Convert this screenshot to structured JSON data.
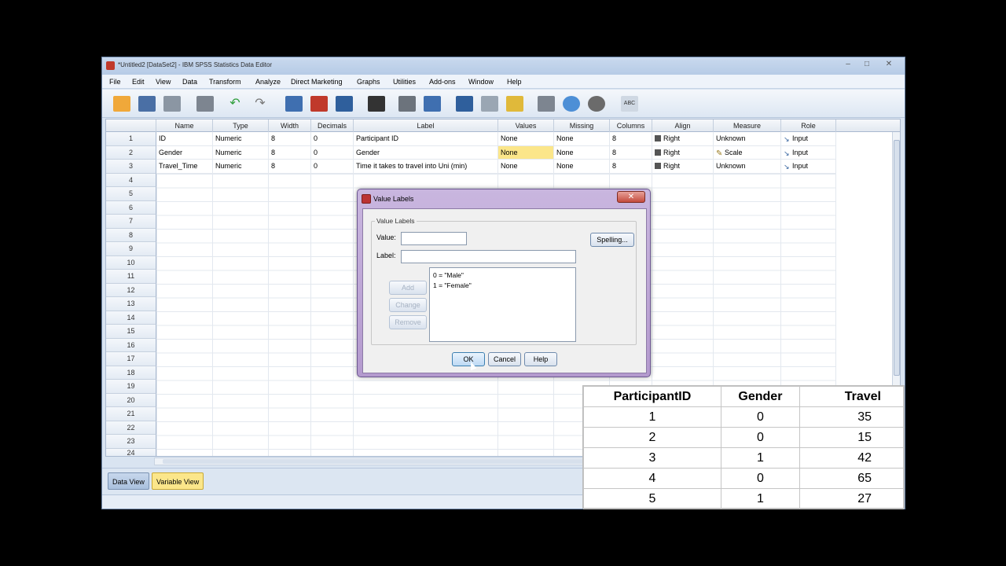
{
  "window": {
    "title": "*Untitled2 [DataSet2] - IBM SPSS Statistics Data Editor",
    "controls": [
      "–",
      "□",
      "✕"
    ]
  },
  "menu": [
    "File",
    "Edit",
    "View",
    "Data",
    "Transform",
    "Analyze",
    "Direct Marketing",
    "Graphs",
    "Utilities",
    "Add-ons",
    "Window",
    "Help"
  ],
  "toolbar": {
    "icons": [
      "open-icon",
      "save-icon",
      "print-icon",
      "dialog-recall-icon",
      "undo-icon",
      "redo-icon",
      "goto-case-icon",
      "goto-variable-icon",
      "variables-icon",
      "find-icon",
      "insert-cases-icon",
      "insert-variable-icon",
      "split-file-icon",
      "weight-cases-icon",
      "select-cases-icon",
      "value-labels-icon",
      "use-sets-icon",
      "show-all-variables-icon",
      "spell-check-icon"
    ]
  },
  "grid": {
    "columns": [
      "Name",
      "Type",
      "Width",
      "Decimals",
      "Label",
      "Values",
      "Missing",
      "Columns",
      "Align",
      "Measure",
      "Role"
    ],
    "rows": [
      [
        "ID",
        "Numeric",
        "8",
        "0",
        "Participant ID",
        "None",
        "None",
        "8",
        "Right",
        "Unknown",
        "Input"
      ],
      [
        "Gender",
        "Numeric",
        "8",
        "0",
        "Gender",
        "None",
        "None",
        "8",
        "Right",
        "Scale",
        "Input"
      ],
      [
        "Travel_Time",
        "Numeric",
        "8",
        "0",
        "Time it takes to travel into Uni (min)",
        "None",
        "None",
        "8",
        "Right",
        "Unknown",
        "Input"
      ]
    ],
    "row_numbers": [
      "1",
      "2",
      "3",
      "4",
      "5",
      "6",
      "7",
      "8",
      "9",
      "10",
      "11",
      "12",
      "13",
      "14",
      "15",
      "16",
      "17",
      "18",
      "19",
      "20",
      "21",
      "22",
      "23",
      "24"
    ]
  },
  "tabs": {
    "data_view": "Data View",
    "variable_view": "Variable View"
  },
  "dialog": {
    "title": "Value Labels",
    "close": "✕",
    "group_label": "Value Labels",
    "value_label": "Value:",
    "label_label": "Label:",
    "value_input": "",
    "label_input": "",
    "list_items": [
      "0 = \"Male\"",
      "1 = \"Female\""
    ],
    "add": "Add",
    "change": "Change",
    "remove": "Remove",
    "spelling": "Spelling...",
    "ok": "OK",
    "cancel": "Cancel",
    "help": "Help"
  },
  "overlay_table": {
    "headers": [
      "ParticipantID",
      "Gender",
      "Travel"
    ],
    "rows": [
      [
        "1",
        "0",
        "35"
      ],
      [
        "2",
        "0",
        "15"
      ],
      [
        "3",
        "1",
        "42"
      ],
      [
        "4",
        "0",
        "65"
      ],
      [
        "5",
        "1",
        "27"
      ]
    ]
  },
  "colors": {
    "selected_cell": "#fbe68a",
    "dialog_frame": "#b49ace",
    "active_tab": "#fbe68a"
  }
}
